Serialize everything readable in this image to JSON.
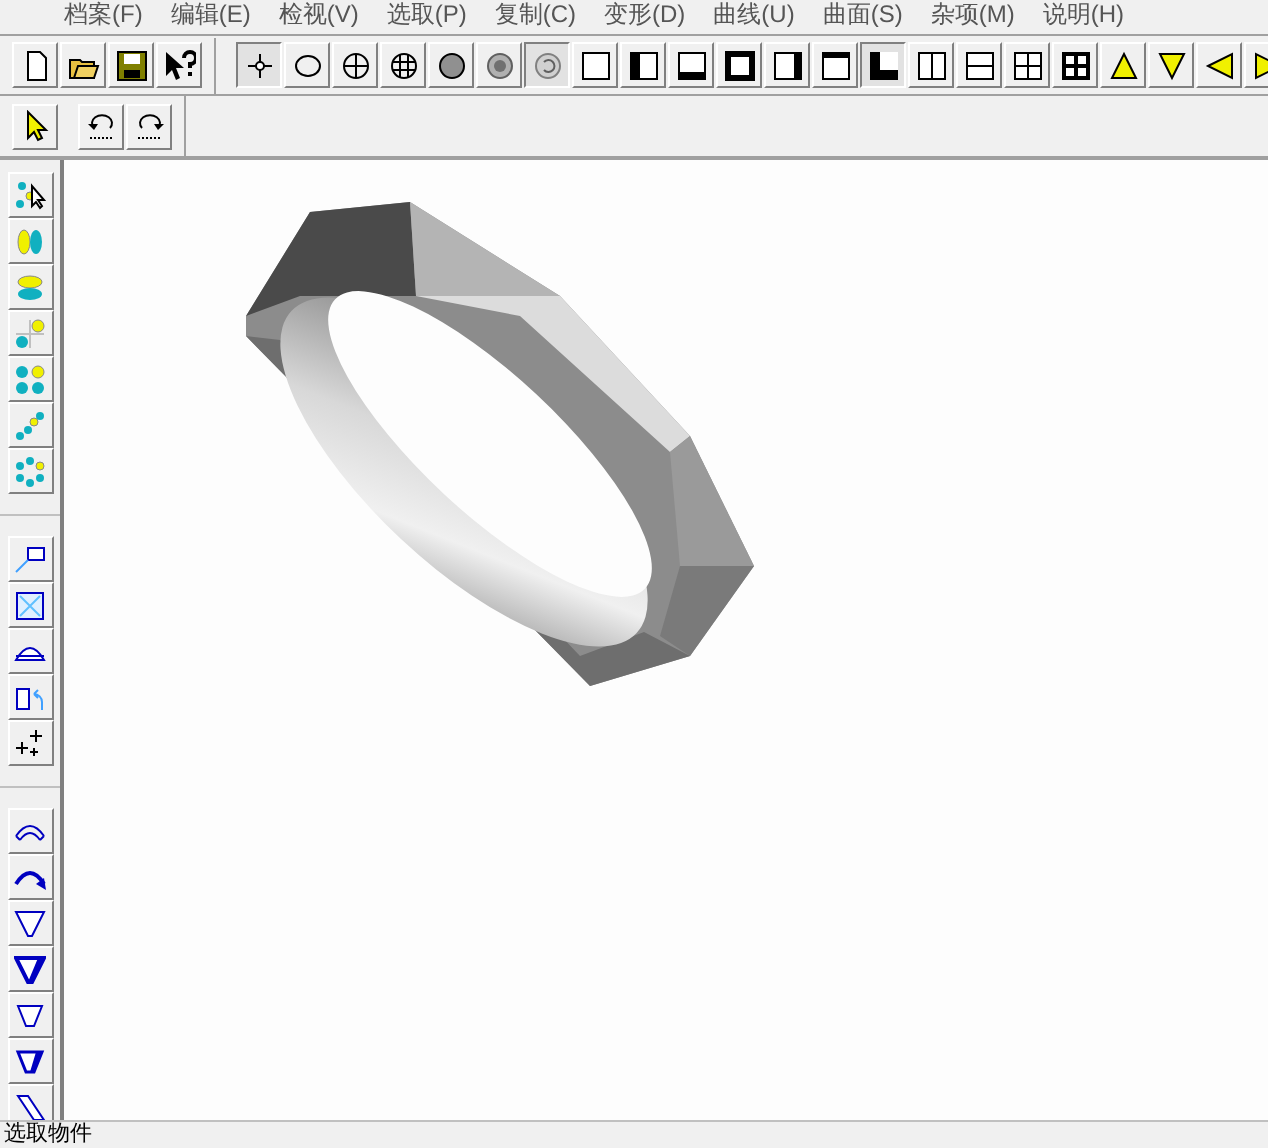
{
  "menu": [
    {
      "label": "档案(F)"
    },
    {
      "label": "编辑(E)"
    },
    {
      "label": "检视(V)"
    },
    {
      "label": "选取(P)"
    },
    {
      "label": "复制(C)"
    },
    {
      "label": "变形(D)"
    },
    {
      "label": "曲线(U)"
    },
    {
      "label": "曲面(S)"
    },
    {
      "label": "杂项(M)"
    },
    {
      "label": "说明(H)"
    }
  ],
  "toolbar_file": [
    {
      "kind": "new",
      "selected": false
    },
    {
      "kind": "open",
      "selected": false
    },
    {
      "kind": "save",
      "selected": false
    },
    {
      "kind": "help",
      "selected": false
    }
  ],
  "toolbar_view": [
    {
      "kind": "point",
      "selected": true
    },
    {
      "kind": "circle",
      "selected": false
    },
    {
      "kind": "circle-cross",
      "selected": false
    },
    {
      "kind": "circle-grid",
      "selected": false
    },
    {
      "kind": "disk",
      "selected": false
    },
    {
      "kind": "disk-hatched",
      "selected": false
    },
    {
      "kind": "disk-rotate",
      "selected": true
    },
    {
      "kind": "box",
      "selected": false
    },
    {
      "kind": "box-left",
      "selected": false
    },
    {
      "kind": "box-bottom",
      "selected": false
    },
    {
      "kind": "box-thick",
      "selected": false
    },
    {
      "kind": "box-right",
      "selected": false
    },
    {
      "kind": "box-top",
      "selected": false
    },
    {
      "kind": "box-corner",
      "selected": true
    },
    {
      "kind": "split-v",
      "selected": false
    },
    {
      "kind": "split-h",
      "selected": false
    },
    {
      "kind": "grid",
      "selected": false
    },
    {
      "kind": "grid-bold",
      "selected": false
    },
    {
      "kind": "tri-up",
      "selected": false
    },
    {
      "kind": "tri-down",
      "selected": false
    },
    {
      "kind": "tri-left",
      "selected": false
    },
    {
      "kind": "tri-right",
      "selected": false
    }
  ],
  "toolbar_edit": [
    {
      "kind": "pointer",
      "selected": false
    },
    {
      "kind": "undo",
      "selected": false
    },
    {
      "kind": "redo",
      "selected": false
    }
  ],
  "side_toolbar": [
    [
      {
        "kind": "dots-select",
        "selected": false
      },
      {
        "kind": "ovals-pair",
        "selected": false
      },
      {
        "kind": "ovals-stack",
        "selected": false
      },
      {
        "kind": "dots-corner",
        "selected": false
      },
      {
        "kind": "dots-four",
        "selected": false
      },
      {
        "kind": "dots-line",
        "selected": false
      },
      {
        "kind": "dots-ring",
        "selected": false
      }
    ],
    [
      {
        "kind": "callout",
        "selected": false
      },
      {
        "kind": "fit",
        "selected": false
      },
      {
        "kind": "arc-flat",
        "selected": false
      },
      {
        "kind": "box-rotate",
        "selected": false
      },
      {
        "kind": "points",
        "selected": false
      }
    ],
    [
      {
        "kind": "arc",
        "selected": false
      },
      {
        "kind": "arc-arrow",
        "selected": false
      },
      {
        "kind": "trap",
        "selected": false
      },
      {
        "kind": "trap-fill",
        "selected": false
      },
      {
        "kind": "trap-small",
        "selected": false
      },
      {
        "kind": "trap-small-fill",
        "selected": false
      },
      {
        "kind": "slant",
        "selected": false
      }
    ]
  ],
  "status_bar": {
    "text": "选取物件"
  }
}
